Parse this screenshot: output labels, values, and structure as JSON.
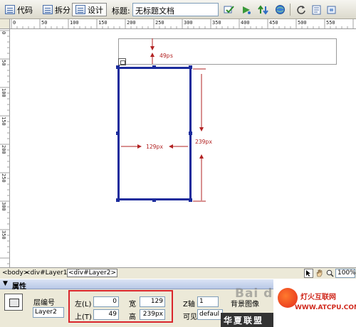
{
  "toolbar": {
    "code_label": "代码",
    "split_label": "拆分",
    "design_label": "设计",
    "title_label": "标题:",
    "title_value": "无标题文档"
  },
  "rulers": {
    "horizontal": [
      "0",
      "50",
      "100",
      "150",
      "200",
      "250",
      "300",
      "350",
      "400",
      "450",
      "500",
      "550"
    ],
    "vertical": [
      "0",
      "50",
      "100",
      "150",
      "200",
      "250",
      "300",
      "350"
    ]
  },
  "canvas": {
    "top_measure": "49ps",
    "width_measure": "129px",
    "height_measure": "239px"
  },
  "statusbar": {
    "tags": [
      "<body>",
      "<div#Layer1>",
      "<div#Layer2>"
    ],
    "zoom": "100%"
  },
  "properties": {
    "title": "属性",
    "layer_id_label": "层编号",
    "layer_id_value": "Layer2",
    "left_label": "左(L)",
    "left_value": "0",
    "top_label": "上(T)",
    "top_value": "49",
    "width_label": "宽",
    "width_value": "129",
    "height_label": "高",
    "height_value": "239px",
    "z_label": "Z轴",
    "z_value": "1",
    "bg_image_label": "背景图像",
    "visibility_label": "可见性",
    "visibility_value": "defaul"
  },
  "watermark": {
    "baidu": "Bai du 经验",
    "brand_cn": "华夏联盟",
    "site_name": "灯火互联网",
    "site_url": "WWW.ATCPU.COM"
  },
  "colors": {
    "layer_border": "#1b2b9c",
    "measure": "#b22222",
    "highlight": "#d9262c"
  }
}
